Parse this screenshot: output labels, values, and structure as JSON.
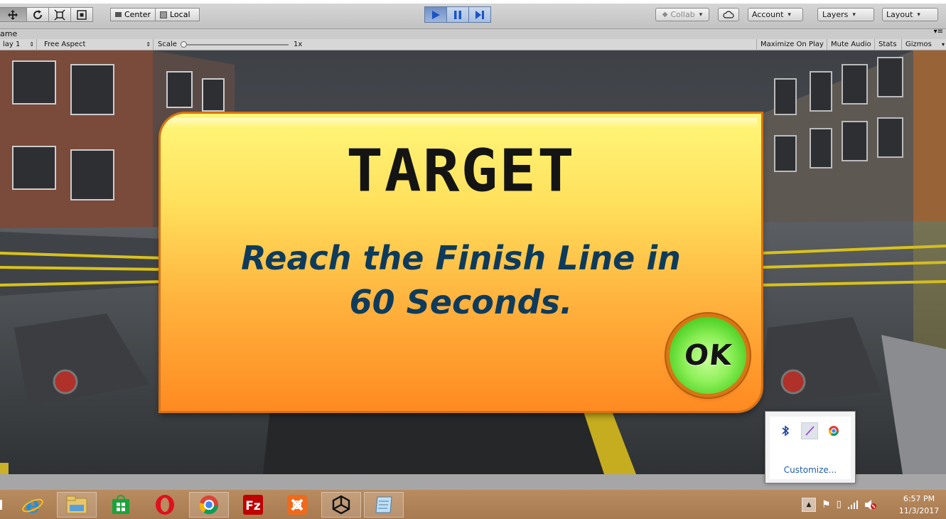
{
  "toolbar": {
    "pivot_center": "Center",
    "pivot_local": "Local",
    "collab": "Collab",
    "account": "Account",
    "layers": "Layers",
    "layout": "Layout"
  },
  "game_view": {
    "tab_label": "ame",
    "display": "lay 1",
    "aspect": "Free Aspect",
    "scale_label": "Scale",
    "scale_value": "1x",
    "maximize": "Maximize On Play",
    "mute": "Mute Audio",
    "stats": "Stats",
    "gizmos": "Gizmos"
  },
  "dialog": {
    "title": "TARGET",
    "message_line1": "Reach the Finish Line in",
    "message_line2": "60 Seconds.",
    "ok": "OK"
  },
  "tray_popup": {
    "customize": "Customize..."
  },
  "taskbar": {
    "apps": [
      "start",
      "internet-explorer",
      "file-explorer",
      "windows-store",
      "opera",
      "chrome",
      "filezilla",
      "xampp",
      "unity",
      "notepad"
    ],
    "time": "6:57 PM",
    "date": "11/3/2017"
  },
  "colors": {
    "dialog_top": "#fff77a",
    "dialog_bottom": "#ff8a22",
    "message_text": "#0e3b5c",
    "ok_green": "#8ff05a",
    "taskbar": "#b08359"
  }
}
